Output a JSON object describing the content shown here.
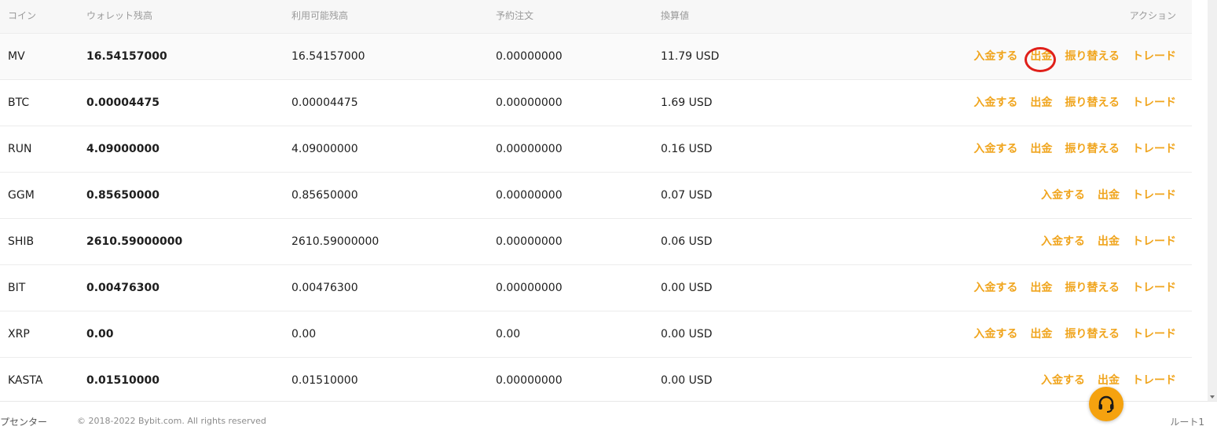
{
  "table": {
    "columns": {
      "coin": "コイン",
      "wallet_balance": "ウォレット残高",
      "available_balance": "利用可能残高",
      "reserved_orders": "予約注文",
      "converted_value": "換算値",
      "actions": "アクション"
    },
    "rows": [
      {
        "coin": "MV",
        "wallet_balance": "16.54157000",
        "available_balance": "16.54157000",
        "reserved_orders": "0.00000000",
        "converted_value": "11.79 USD",
        "actions": [
          "入金する",
          "出金",
          "振り替える",
          "トレード"
        ],
        "highlighted_action": "出金"
      },
      {
        "coin": "BTC",
        "wallet_balance": "0.00004475",
        "available_balance": "0.00004475",
        "reserved_orders": "0.00000000",
        "converted_value": "1.69 USD",
        "actions": [
          "入金する",
          "出金",
          "振り替える",
          "トレード"
        ]
      },
      {
        "coin": "RUN",
        "wallet_balance": "4.09000000",
        "available_balance": "4.09000000",
        "reserved_orders": "0.00000000",
        "converted_value": "0.16 USD",
        "actions": [
          "入金する",
          "出金",
          "振り替える",
          "トレード"
        ]
      },
      {
        "coin": "GGM",
        "wallet_balance": "0.85650000",
        "available_balance": "0.85650000",
        "reserved_orders": "0.00000000",
        "converted_value": "0.07 USD",
        "actions": [
          "入金する",
          "出金",
          "トレード"
        ]
      },
      {
        "coin": "SHIB",
        "wallet_balance": "2610.59000000",
        "available_balance": "2610.59000000",
        "reserved_orders": "0.00000000",
        "converted_value": "0.06 USD",
        "actions": [
          "入金する",
          "出金",
          "トレード"
        ]
      },
      {
        "coin": "BIT",
        "wallet_balance": "0.00476300",
        "available_balance": "0.00476300",
        "reserved_orders": "0.00000000",
        "converted_value": "0.00 USD",
        "actions": [
          "入金する",
          "出金",
          "振り替える",
          "トレード"
        ]
      },
      {
        "coin": "XRP",
        "wallet_balance": "0.00",
        "available_balance": "0.00",
        "reserved_orders": "0.00",
        "converted_value": "0.00 USD",
        "actions": [
          "入金する",
          "出金",
          "振り替える",
          "トレード"
        ]
      },
      {
        "coin": "KASTA",
        "wallet_balance": "0.01510000",
        "available_balance": "0.01510000",
        "reserved_orders": "0.00000000",
        "converted_value": "0.00 USD",
        "actions": [
          "入金する",
          "出金",
          "トレード"
        ]
      }
    ]
  },
  "footer": {
    "help_link": "プセンター",
    "copyright": "© 2018-2022 Bybit.com. All rights reserved",
    "route": "ルート1"
  },
  "support": {
    "icon": "headset-icon"
  },
  "colors": {
    "accent": "#f0a51e",
    "annotation_circle": "#e0201a",
    "support_button": "#f5a20f"
  }
}
